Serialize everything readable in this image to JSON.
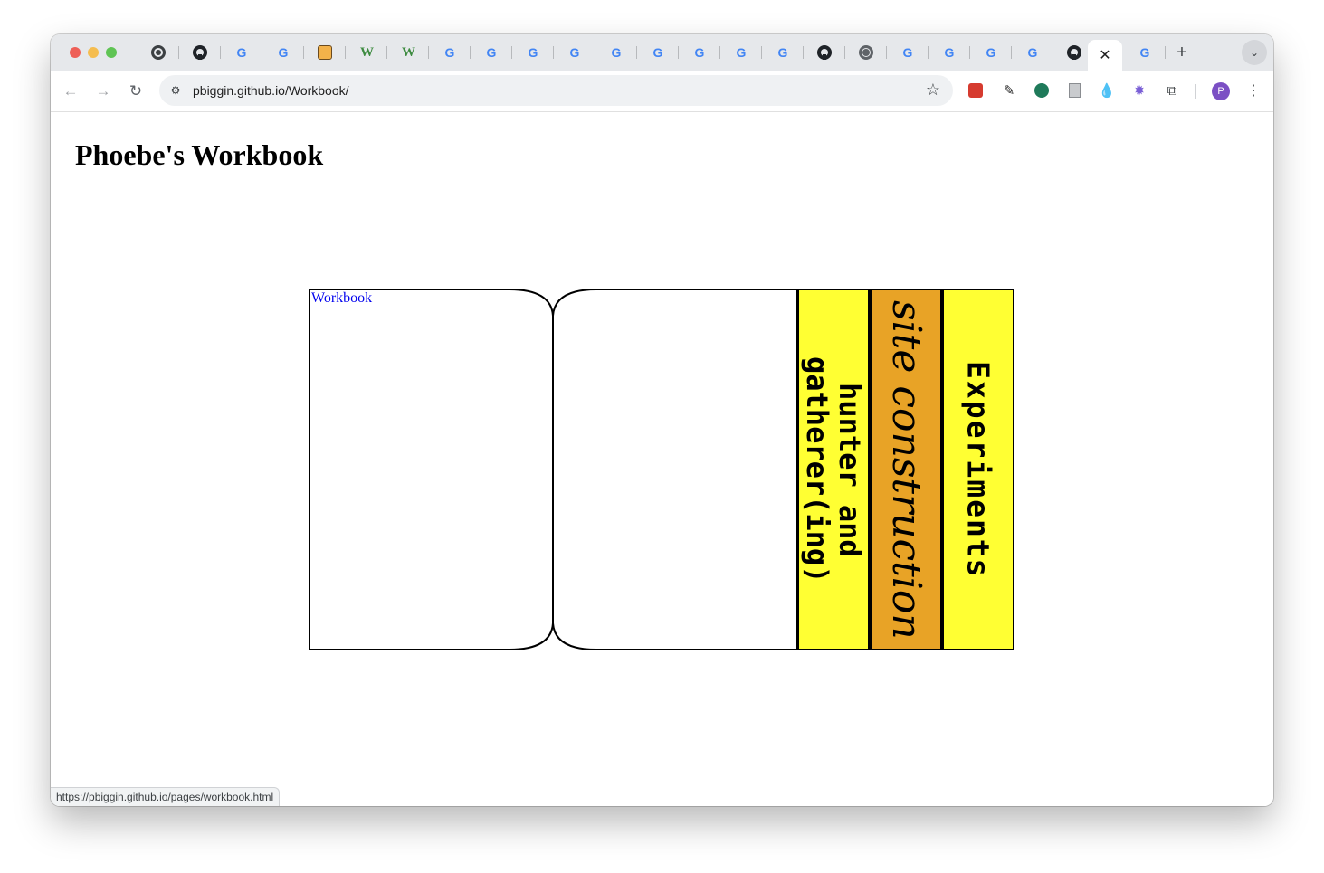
{
  "browser": {
    "tabs": [
      {
        "icon": "chrome-icon"
      },
      {
        "icon": "github-icon"
      },
      {
        "icon": "google-icon",
        "glyph": "G"
      },
      {
        "icon": "google-icon",
        "glyph": "G"
      },
      {
        "icon": "image-icon"
      },
      {
        "icon": "wiki-icon",
        "glyph": "W"
      },
      {
        "icon": "wiki-icon",
        "glyph": "W"
      },
      {
        "icon": "google-icon",
        "glyph": "G"
      },
      {
        "icon": "google-icon",
        "glyph": "G"
      },
      {
        "icon": "google-icon",
        "glyph": "G"
      },
      {
        "icon": "google-icon",
        "glyph": "G"
      },
      {
        "icon": "google-icon",
        "glyph": "G"
      },
      {
        "icon": "google-icon",
        "glyph": "G"
      },
      {
        "icon": "google-icon",
        "glyph": "G"
      },
      {
        "icon": "google-icon",
        "glyph": "G"
      },
      {
        "icon": "google-icon",
        "glyph": "G"
      },
      {
        "icon": "github-icon"
      },
      {
        "icon": "globe-icon"
      },
      {
        "icon": "google-icon",
        "glyph": "G"
      },
      {
        "icon": "google-icon",
        "glyph": "G"
      },
      {
        "icon": "google-icon",
        "glyph": "G"
      },
      {
        "icon": "google-icon",
        "glyph": "G"
      },
      {
        "icon": "github-icon"
      }
    ],
    "active_tab_close": "✕",
    "after_tab_glyph": "G",
    "new_tab": "+",
    "tab_menu": "⌄",
    "nav": {
      "back": "←",
      "forward": "→",
      "reload": "↻"
    },
    "address": "pbiggin.github.io/Workbook/",
    "site_icon": "⚙",
    "star": "☆",
    "avatar_letter": "P",
    "kebab": "⋮",
    "extension_glyphs": {
      "eyedropper": "✎",
      "drop": "💧",
      "gear": "✹",
      "puzzle": "⧉"
    },
    "status_url": "https://pbiggin.github.io/pages/workbook.html"
  },
  "page": {
    "title": "Phoebe's Workbook",
    "book_link": "Workbook",
    "spines": [
      {
        "label": "hunter and gatherer(ing)",
        "color": "#ffff33"
      },
      {
        "label": "site construction",
        "color": "#e8a326"
      },
      {
        "label": "Experiments",
        "color": "#ffff33"
      }
    ]
  },
  "colors": {
    "link": "#0000ee",
    "spine_yellow": "#ffff33",
    "spine_orange": "#e8a326",
    "close_red": "#ee5f57",
    "minimize_yellow": "#f5bd4f",
    "zoom_green": "#5fc454",
    "avatar_purple": "#7b4fc4"
  }
}
